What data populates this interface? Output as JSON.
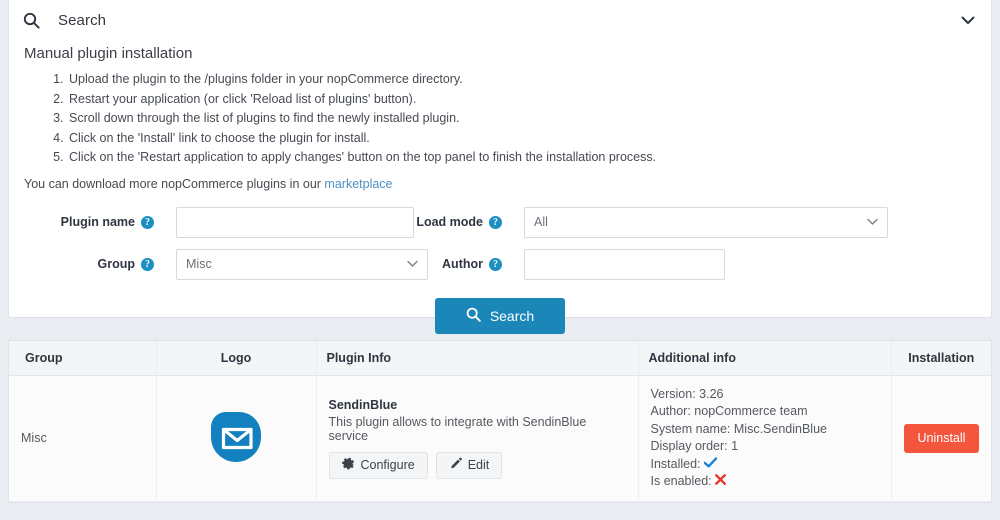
{
  "search_panel": {
    "title": "Search",
    "search_icon": "search-icon",
    "collapse_icon": "chevron-down-icon",
    "instructions": {
      "heading": "Manual plugin installation",
      "steps": [
        "Upload the plugin to the /plugins folder in your nopCommerce directory.",
        "Restart your application (or click 'Reload list of plugins' button).",
        "Scroll down through the list of plugins to find the newly installed plugin.",
        "Click on the 'Install' link to choose the plugin for install.",
        "Click on the 'Restart application to apply changes' button on the top panel to finish the installation process."
      ],
      "note_prefix": "You can download more nopCommerce plugins in our ",
      "note_link": "marketplace"
    },
    "fields": {
      "plugin_name": {
        "label": "Plugin name",
        "value": "",
        "placeholder": "",
        "hint_icon": "help-icon"
      },
      "group": {
        "label": "Group",
        "value": "Misc",
        "hint_icon": "help-icon",
        "chevron_icon": "chevron-down-icon"
      },
      "load_mode": {
        "label": "Load mode",
        "value": "All",
        "hint_icon": "help-icon",
        "chevron_icon": "chevron-down-icon"
      },
      "author": {
        "label": "Author",
        "value": "",
        "placeholder": "",
        "hint_icon": "help-icon"
      }
    },
    "search_button": {
      "label": "Search",
      "icon": "search-icon",
      "color": "#1b86b8"
    }
  },
  "results_table": {
    "columns": [
      "Group",
      "Logo",
      "Plugin Info",
      "Additional info",
      "Installation"
    ],
    "rows": [
      {
        "group": "Misc",
        "logo_icon": "sendinblue-logo-icon",
        "plugin_name": "SendinBlue",
        "plugin_description": "This plugin allows to integrate with SendinBlue service",
        "actions": [
          {
            "label": "Configure",
            "icon": "gear-icon"
          },
          {
            "label": "Edit",
            "icon": "pencil-icon"
          }
        ],
        "additional_info": [
          {
            "label": "Version:",
            "value": "3.26"
          },
          {
            "label": "Author:",
            "value": "nopCommerce team"
          },
          {
            "label": "System name:",
            "value": "Misc.SendinBlue"
          },
          {
            "label": "Display order:",
            "value": "1"
          },
          {
            "label": "Installed:",
            "mark": "check",
            "mark_icon": "check-icon"
          },
          {
            "label": "Is enabled:",
            "mark": "cross",
            "mark_icon": "cross-icon"
          }
        ],
        "installation": {
          "label": "Uninstall",
          "color": "#f4553d"
        }
      }
    ]
  },
  "colors": {
    "accent": "#1b86b8",
    "danger": "#f4553d",
    "link": "#4a90c4",
    "hint": "#1b8ec2",
    "check": "#1b86d4",
    "cross": "#e8342a",
    "page_bg": "#e9ecf0"
  }
}
